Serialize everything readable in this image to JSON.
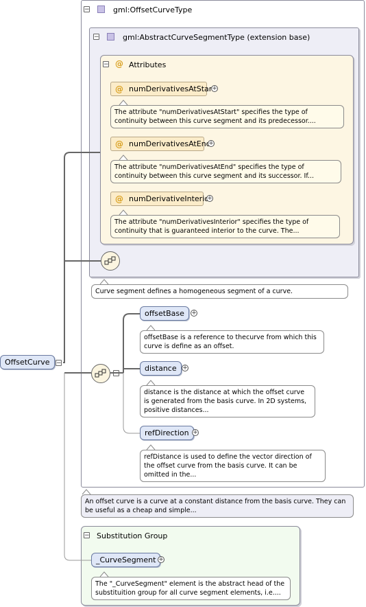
{
  "complex_type": {
    "label": "gml:OffsetCurveType"
  },
  "base_type": {
    "label": "gml:AbstractCurveSegmentType (extension base)"
  },
  "attributes": {
    "header": "Attributes",
    "items": [
      {
        "name": "numDerivativesAtStart",
        "note": "The attribute \"numDerivativesAtStart\" specifies the type of continuity between this curve segment and its predecessor...."
      },
      {
        "name": "numDerivativesAtEnd",
        "note": "The attribute \"numDerivativesAtEnd\" specifies the type of continuity between this curve segment and its successor. If..."
      },
      {
        "name": "numDerivativeInterior",
        "note": "The attribute \"numDerivativesInterior\" specifies the type of continuity that is guaranteed interior to the curve. The..."
      }
    ]
  },
  "base_note": "Curve segment defines a homogeneous segment of a curve.",
  "elements": [
    {
      "name": "offsetBase",
      "note": "offsetBase is a reference to thecurve from which this curve is define as an offset."
    },
    {
      "name": "distance",
      "note": "distance is the distance at which the offset curve is generated from the basis curve. In 2D systems, positive distances..."
    },
    {
      "name": "refDirection",
      "note": "refDistance is used to define the vector direction of the offset curve from the basis curve. It can be omitted in the..."
    }
  ],
  "root": {
    "name": "OffsetCurve",
    "note": "An offset curve is a curve at a constant distance from the basis curve. They can be useful as a cheap and simple..."
  },
  "substitution": {
    "header": "Substitution Group",
    "element": "_CurveSegment",
    "note": "The \"_CurveSegment\" element is the abstract head of the substituition group for all curve segment elements, i.e...."
  },
  "icons": {
    "minus": "−",
    "plus": "+",
    "at": "@"
  },
  "colors": {
    "attr_bg": "#fbecc9",
    "element_bg": "#dfe7f7",
    "complex_bg": "#eeeef6",
    "subst_bg": "#f2fbef"
  }
}
